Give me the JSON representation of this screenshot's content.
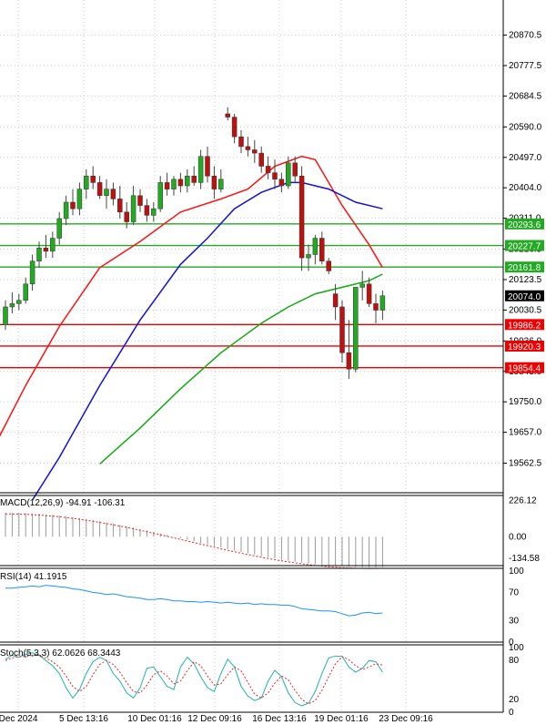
{
  "chart_data": {
    "type": "candlestick",
    "price_axis": {
      "ylim": [
        19500,
        20950
      ],
      "ticks": [
        20870.5,
        20777.5,
        20684.5,
        20590.0,
        20497.0,
        20404.0,
        20311.0,
        20216.5,
        20123.5,
        20030.5,
        19936.0,
        19843.0,
        19750.0,
        19657.0,
        19562.5
      ]
    },
    "x_labels": [
      "Dec 2024",
      "5 Dec 13:16",
      "10 Dec 01:16",
      "12 Dec 09:16",
      "16 Dec 13:16",
      "19 Dec 01:16",
      "23 Dec 09:16"
    ],
    "horizontal_lines": [
      {
        "value": 20293.6,
        "label": "20293.6",
        "color": "#22aa22"
      },
      {
        "value": 20227.7,
        "label": "20227.7",
        "color": "#22aa22"
      },
      {
        "value": 20161.8,
        "label": "20161.8",
        "color": "#22aa22"
      },
      {
        "value": 19986.2,
        "label": "19986.2",
        "color": "#ee0000"
      },
      {
        "value": 19920.3,
        "label": "19920.3",
        "color": "#ee0000"
      },
      {
        "value": 19854.4,
        "label": "19854.4",
        "color": "#ee0000"
      }
    ],
    "current_price": {
      "value": 20074.0,
      "label": "20074.0"
    },
    "candles": [
      {
        "o": 19985,
        "h": 20060,
        "l": 19970,
        "c": 20040
      },
      {
        "o": 20040,
        "h": 20085,
        "l": 20020,
        "c": 20050
      },
      {
        "o": 20050,
        "h": 20080,
        "l": 20030,
        "c": 20060
      },
      {
        "o": 20060,
        "h": 20130,
        "l": 20050,
        "c": 20110
      },
      {
        "o": 20110,
        "h": 20200,
        "l": 20090,
        "c": 20180
      },
      {
        "o": 20180,
        "h": 20240,
        "l": 20160,
        "c": 20220
      },
      {
        "o": 20220,
        "h": 20260,
        "l": 20190,
        "c": 20210
      },
      {
        "o": 20210,
        "h": 20270,
        "l": 20190,
        "c": 20250
      },
      {
        "o": 20250,
        "h": 20330,
        "l": 20230,
        "c": 20310
      },
      {
        "o": 20310,
        "h": 20380,
        "l": 20290,
        "c": 20360
      },
      {
        "o": 20360,
        "h": 20400,
        "l": 20320,
        "c": 20340
      },
      {
        "o": 20340,
        "h": 20420,
        "l": 20320,
        "c": 20400
      },
      {
        "o": 20400,
        "h": 20460,
        "l": 20370,
        "c": 20440
      },
      {
        "o": 20440,
        "h": 20470,
        "l": 20400,
        "c": 20420
      },
      {
        "o": 20420,
        "h": 20440,
        "l": 20370,
        "c": 20380
      },
      {
        "o": 20380,
        "h": 20430,
        "l": 20340,
        "c": 20400
      },
      {
        "o": 20400,
        "h": 20420,
        "l": 20350,
        "c": 20370
      },
      {
        "o": 20370,
        "h": 20410,
        "l": 20310,
        "c": 20330
      },
      {
        "o": 20330,
        "h": 20360,
        "l": 20280,
        "c": 20300
      },
      {
        "o": 20300,
        "h": 20410,
        "l": 20290,
        "c": 20380
      },
      {
        "o": 20380,
        "h": 20400,
        "l": 20330,
        "c": 20350
      },
      {
        "o": 20350,
        "h": 20370,
        "l": 20300,
        "c": 20320
      },
      {
        "o": 20320,
        "h": 20360,
        "l": 20300,
        "c": 20340
      },
      {
        "o": 20340,
        "h": 20440,
        "l": 20330,
        "c": 20420
      },
      {
        "o": 20420,
        "h": 20450,
        "l": 20380,
        "c": 20400
      },
      {
        "o": 20400,
        "h": 20440,
        "l": 20380,
        "c": 20430
      },
      {
        "o": 20430,
        "h": 20450,
        "l": 20390,
        "c": 20410
      },
      {
        "o": 20410,
        "h": 20460,
        "l": 20390,
        "c": 20440
      },
      {
        "o": 20440,
        "h": 20470,
        "l": 20410,
        "c": 20420
      },
      {
        "o": 20420,
        "h": 20520,
        "l": 20400,
        "c": 20500
      },
      {
        "o": 20500,
        "h": 20530,
        "l": 20420,
        "c": 20440
      },
      {
        "o": 20440,
        "h": 20470,
        "l": 20370,
        "c": 20400
      },
      {
        "o": 20400,
        "h": 20460,
        "l": 20390,
        "c": 20430
      },
      {
        "o": 20630,
        "h": 20650,
        "l": 20610,
        "c": 20620
      },
      {
        "o": 20620,
        "h": 20630,
        "l": 20540,
        "c": 20560
      },
      {
        "o": 20560,
        "h": 20580,
        "l": 20510,
        "c": 20530
      },
      {
        "o": 20530,
        "h": 20560,
        "l": 20500,
        "c": 20520
      },
      {
        "o": 20520,
        "h": 20550,
        "l": 20480,
        "c": 20510
      },
      {
        "o": 20510,
        "h": 20530,
        "l": 20450,
        "c": 20470
      },
      {
        "o": 20470,
        "h": 20500,
        "l": 20430,
        "c": 20450
      },
      {
        "o": 20450,
        "h": 20490,
        "l": 20400,
        "c": 20430
      },
      {
        "o": 20430,
        "h": 20450,
        "l": 20390,
        "c": 20410
      },
      {
        "o": 20410,
        "h": 20500,
        "l": 20400,
        "c": 20480
      },
      {
        "o": 20480,
        "h": 20500,
        "l": 20420,
        "c": 20440
      },
      {
        "o": 20440,
        "h": 20470,
        "l": 20150,
        "c": 20190
      },
      {
        "o": 20190,
        "h": 20230,
        "l": 20150,
        "c": 20200
      },
      {
        "o": 20200,
        "h": 20260,
        "l": 20170,
        "c": 20250
      },
      {
        "o": 20250,
        "h": 20270,
        "l": 20170,
        "c": 20180
      },
      {
        "o": 20180,
        "h": 20190,
        "l": 20140,
        "c": 20150
      },
      {
        "o": 20080,
        "h": 20110,
        "l": 20000,
        "c": 20040
      },
      {
        "o": 20040,
        "h": 20060,
        "l": 19870,
        "c": 19900
      },
      {
        "o": 19900,
        "h": 20000,
        "l": 19820,
        "c": 19850
      },
      {
        "o": 19850,
        "h": 20100,
        "l": 19840,
        "c": 20100
      },
      {
        "o": 20100,
        "h": 20150,
        "l": 20060,
        "c": 20110
      },
      {
        "o": 20110,
        "h": 20130,
        "l": 20040,
        "c": 20050
      },
      {
        "o": 20050,
        "h": 20080,
        "l": 19990,
        "c": 20030
      },
      {
        "o": 20030,
        "h": 20090,
        "l": 20000,
        "c": 20074
      }
    ],
    "moving_averages": [
      {
        "color": "#ff1111",
        "points": [
          [
            -3,
            19560
          ],
          [
            3,
            19800
          ],
          [
            8,
            19980
          ],
          [
            14,
            20160
          ],
          [
            20,
            20240
          ],
          [
            26,
            20330
          ],
          [
            32,
            20370
          ],
          [
            36,
            20400
          ],
          [
            40,
            20470
          ],
          [
            44,
            20500
          ],
          [
            46,
            20490
          ],
          [
            50,
            20350
          ],
          [
            54,
            20230
          ],
          [
            56,
            20160
          ]
        ]
      },
      {
        "color": "#1111dd",
        "points": [
          [
            4,
            19450
          ],
          [
            8,
            19580
          ],
          [
            14,
            19800
          ],
          [
            20,
            20000
          ],
          [
            26,
            20170
          ],
          [
            30,
            20250
          ],
          [
            34,
            20340
          ],
          [
            38,
            20390
          ],
          [
            42,
            20420
          ],
          [
            44,
            20420
          ],
          [
            48,
            20400
          ],
          [
            52,
            20360
          ],
          [
            56,
            20340
          ]
        ]
      },
      {
        "color": "#11aa11",
        "points": [
          [
            14,
            19560
          ],
          [
            20,
            19670
          ],
          [
            26,
            19790
          ],
          [
            32,
            19900
          ],
          [
            38,
            19990
          ],
          [
            42,
            20040
          ],
          [
            46,
            20080
          ],
          [
            50,
            20100
          ],
          [
            54,
            20120
          ],
          [
            56,
            20140
          ]
        ]
      }
    ],
    "macd": {
      "label": "MACD(12,26,9) -94.91 -106.31",
      "ticks": [
        226.12,
        0.0,
        -134.58
      ],
      "ylim": [
        -180,
        240
      ]
    },
    "rsi": {
      "label": "RSI(14) 41.1915",
      "ticks": [
        100,
        70,
        30,
        0
      ],
      "values": [
        76,
        76,
        77,
        78,
        79,
        78,
        80,
        79,
        78,
        77,
        75,
        74,
        72,
        70,
        69,
        67,
        68,
        66,
        64,
        63,
        62,
        60,
        60,
        61,
        60,
        58,
        58,
        57,
        57,
        56,
        57,
        56,
        55,
        56,
        55,
        54,
        55,
        53,
        54,
        53,
        53,
        52,
        52,
        50,
        47,
        46,
        45,
        44,
        44,
        43,
        40,
        37,
        38,
        41,
        42,
        40,
        41
      ]
    },
    "stoch": {
      "label": "Stoch(5,3,3) 62.0626 68.3443",
      "ticks": [
        100,
        80,
        20,
        0
      ],
      "k": [
        82,
        88,
        85,
        90,
        92,
        88,
        80,
        72,
        60,
        38,
        22,
        35,
        60,
        78,
        85,
        80,
        60,
        48,
        30,
        22,
        38,
        68,
        70,
        55,
        40,
        35,
        70,
        85,
        75,
        55,
        38,
        32,
        60,
        82,
        70,
        40,
        25,
        18,
        22,
        48,
        65,
        55,
        30,
        15,
        10,
        14,
        32,
        60,
        84,
        87,
        86,
        70,
        62,
        68,
        80,
        78,
        62
      ],
      "d": [
        80,
        84,
        86,
        86,
        88,
        88,
        84,
        78,
        70,
        56,
        40,
        32,
        40,
        58,
        74,
        80,
        74,
        62,
        46,
        32,
        30,
        42,
        58,
        64,
        56,
        44,
        48,
        64,
        78,
        72,
        56,
        42,
        44,
        58,
        70,
        64,
        46,
        28,
        22,
        30,
        45,
        56,
        50,
        34,
        20,
        13,
        18,
        34,
        55,
        75,
        86,
        81,
        72,
        66,
        70,
        75,
        73
      ]
    }
  }
}
